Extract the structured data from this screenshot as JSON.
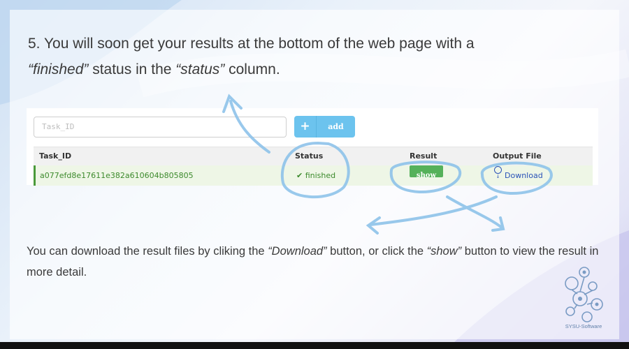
{
  "slide": {
    "heading_line1": "5. You will soon get your results at the bottom of the web page with a",
    "heading_finished": "“finished”",
    "heading_mid": " status in the ",
    "heading_status": "“status”",
    "heading_end": " column.",
    "body_p1": "You can download the result files by cliking the ",
    "body_download": "“Download”",
    "body_p2": " button, or click the ",
    "body_show": "“show”",
    "body_p3": " button to view the result in more detail.",
    "logo_text": "SYSU-Software"
  },
  "app": {
    "input_placeholder": "Task_ID",
    "add_icon": "+",
    "add_label": "add",
    "columns": [
      "Task_ID",
      "Status",
      "Result",
      "Output File"
    ],
    "rows": [
      {
        "task_id": "a077efd8e17611e382a610604b805805",
        "status_icon": "✔",
        "status": "finished",
        "result_label": "show",
        "output_icon": "download-circle-icon",
        "output_label": "Download"
      }
    ]
  },
  "colors": {
    "annotation": "#8ec3ea",
    "success": "#3c8a2c",
    "add_button": "#6cc3ee",
    "show_button": "#55b15a",
    "link": "#2a52b8"
  }
}
